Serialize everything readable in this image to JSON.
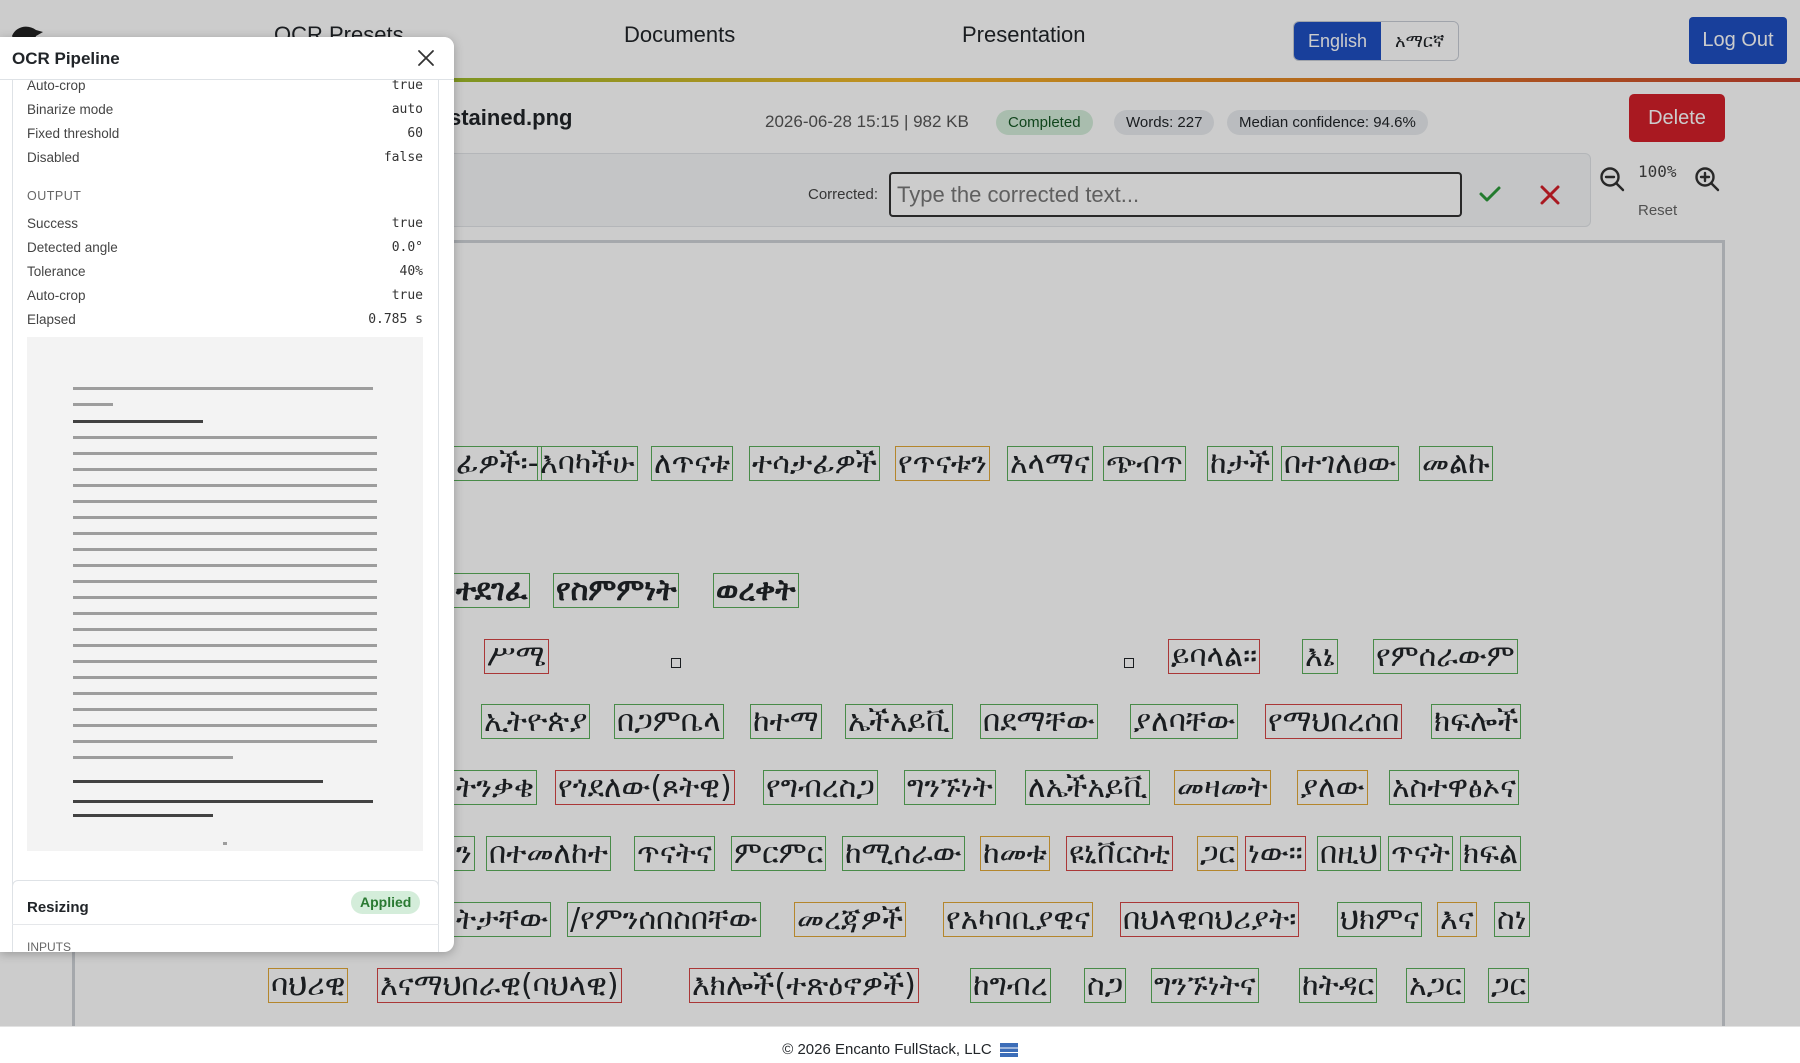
{
  "nav": {
    "presets_label": "OCR Presets",
    "documents_label": "Documents",
    "presentation_label": "Presentation",
    "lang_english": "English",
    "lang_amharic": "አማርኛ",
    "logout_label": "Log Out"
  },
  "doc": {
    "title": "stained.png",
    "meta": "2026-06-28 15:15 | 982 KB",
    "status": "Completed",
    "words": "Words: 227",
    "confidence": "Median confidence: 94.6%",
    "delete_label": "Delete"
  },
  "correction": {
    "label": "Corrected:",
    "placeholder": "Type the corrected text..."
  },
  "zoom": {
    "level": "100%",
    "reset_label": "Reset"
  },
  "panel": {
    "title": "OCR Pipeline",
    "top_rows": [
      {
        "k": "Auto-crop",
        "v": "true"
      },
      {
        "k": "Binarize mode",
        "v": "auto"
      },
      {
        "k": "Fixed threshold",
        "v": "60"
      },
      {
        "k": "Disabled",
        "v": "false"
      }
    ],
    "output_title": "OUTPUT",
    "output_rows": [
      {
        "k": "Success",
        "v": "true"
      },
      {
        "k": "Detected angle",
        "v": "0.0°"
      },
      {
        "k": "Tolerance",
        "v": "40%"
      },
      {
        "k": "Auto-crop",
        "v": "true"
      },
      {
        "k": "Elapsed",
        "v": "0.785 s"
      }
    ],
    "resize_title": "Resizing",
    "resize_status": "Applied",
    "inputs_title": "INPUTS"
  },
  "words": [
    {
      "t": "ፊዎች፡-",
      "c": "g"
    },
    {
      "t": "እባካችሁ",
      "c": "g"
    },
    {
      "t": "ለጥናቱ",
      "c": "g"
    },
    {
      "t": "ተሳታፊዎች",
      "c": "g"
    },
    {
      "t": "የጥናቱን",
      "c": "o"
    },
    {
      "t": "አላማና",
      "c": "g"
    },
    {
      "t": "ጭብጥ",
      "c": "g"
    },
    {
      "t": "ከታች",
      "c": "g"
    },
    {
      "t": "በተገለፀው",
      "c": "g"
    },
    {
      "t": "መልኩ",
      "c": "g"
    },
    {
      "t": "ተደገፈ",
      "c": "g"
    },
    {
      "t": "የስምምነት",
      "c": "g"
    },
    {
      "t": "ወረቀት",
      "c": "g"
    },
    {
      "t": "ሥሜ",
      "c": "r"
    },
    {
      "t": "ይባላል።",
      "c": "r"
    },
    {
      "t": "እኔ",
      "c": "g"
    },
    {
      "t": "የምሰራውም",
      "c": "g"
    },
    {
      "t": "ኢትዮጵያ",
      "c": "g"
    },
    {
      "t": "በጋምቤላ",
      "c": "g"
    },
    {
      "t": "ከተማ",
      "c": "g"
    },
    {
      "t": "ኤችአይቪ",
      "c": "g"
    },
    {
      "t": "በደማቸው",
      "c": "g"
    },
    {
      "t": "ያለባቸው",
      "c": "g"
    },
    {
      "t": "የማህበረሰበ",
      "c": "r"
    },
    {
      "t": "ክፍሎች",
      "c": "g"
    },
    {
      "t": "ትንቃቄ",
      "c": "g"
    },
    {
      "t": "የጎደለው(ጾትዊ)",
      "c": "r"
    },
    {
      "t": "የግብረስጋ",
      "c": "g"
    },
    {
      "t": "ግንኙነት",
      "c": "g"
    },
    {
      "t": "ለኤችአይቪ",
      "c": "g"
    },
    {
      "t": "መዛመት",
      "c": "o"
    },
    {
      "t": "ያለው",
      "c": "o"
    },
    {
      "t": "አስተዋፅኦና",
      "c": "g"
    },
    {
      "t": "ን",
      "c": "g"
    },
    {
      "t": "በተመለከተ",
      "c": "g"
    },
    {
      "t": "ጥናትና",
      "c": "g"
    },
    {
      "t": "ምርምር",
      "c": "g"
    },
    {
      "t": "ከሚሰራው",
      "c": "g"
    },
    {
      "t": "ከመቱ",
      "c": "o"
    },
    {
      "t": "ዩኒቨርስቲ",
      "c": "r"
    },
    {
      "t": "ጋር",
      "c": "o"
    },
    {
      "t": "ነው።",
      "c": "r"
    },
    {
      "t": "በዚህ",
      "c": "g"
    },
    {
      "t": "ጥናት",
      "c": "g"
    },
    {
      "t": "ክፍል",
      "c": "g"
    },
    {
      "t": "ትታቸው",
      "c": "g"
    },
    {
      "t": "/የምንሰበስበቸው",
      "c": "g"
    },
    {
      "t": "መረጃዎች",
      "c": "o"
    },
    {
      "t": "የአካባቢያዊና",
      "c": "o"
    },
    {
      "t": "በህላዊባህሪያት፡",
      "c": "r"
    },
    {
      "t": "ህክምና",
      "c": "g"
    },
    {
      "t": "እና",
      "c": "o"
    },
    {
      "t": "ስነ",
      "c": "g"
    },
    {
      "t": "ባህሪዊ",
      "c": "o"
    },
    {
      "t": "እናማህበራዊ(ባህላዊ)",
      "c": "r"
    },
    {
      "t": "እክሎች(ተጽዕኖዎች)",
      "c": "r"
    },
    {
      "t": "ከግብረ",
      "c": "g"
    },
    {
      "t": "ስጋ",
      "c": "g"
    },
    {
      "t": "ግንኙነትና",
      "c": "g"
    },
    {
      "t": "ከትዳር",
      "c": "g"
    },
    {
      "t": "አጋር",
      "c": "g"
    },
    {
      "t": "ጋር",
      "c": "g"
    }
  ],
  "footer": {
    "text": "© 2026 Encanto FullStack, LLC"
  }
}
